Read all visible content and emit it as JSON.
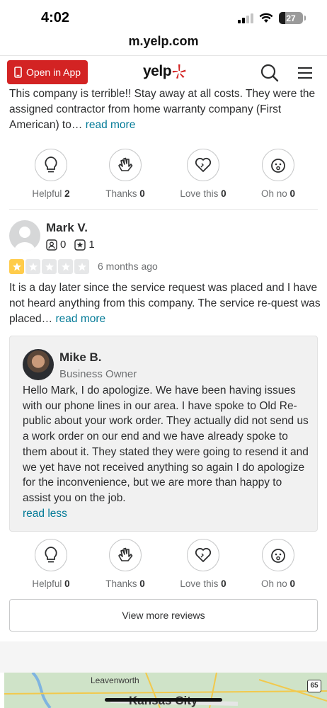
{
  "status_bar": {
    "time": "4:02",
    "battery": "27"
  },
  "browser": {
    "url": "m.yelp.com"
  },
  "header": {
    "open_in_app": "Open in App",
    "logo_text": "yelp",
    "brand_color": "#d32323"
  },
  "previous_review": {
    "text": "This company is terrible!! Stay away at all costs. They were the assigned contractor from home warranty company (First American) to…",
    "read_more": "read more",
    "reactions": [
      {
        "label": "Helpful",
        "count": "2"
      },
      {
        "label": "Thanks",
        "count": "0"
      },
      {
        "label": "Love this",
        "count": "0"
      },
      {
        "label": "Oh no",
        "count": "0"
      }
    ]
  },
  "review": {
    "reviewer_name": "Mark V.",
    "friends": "0",
    "reviews": "1",
    "rating": 1,
    "date": "6 months ago",
    "text": "It is a day later since the service request was placed and I have not heard anything from this company. The service re-quest was placed…",
    "read_more": "read more",
    "owner_reply": {
      "name": "Mike B.",
      "role": "Business Owner",
      "text": "Hello Mark, I do apologize. We have been having issues with our phone lines in our area. I have spoke to Old Re-public about your work order. They actually did not send us a work order on our end and we have already spoke to them about it. They stated they were going to resend it and we yet have not received anything so again I do apologize for the inconvenience, but we are more than happy to assist you on the job.",
      "read_less": "read less"
    },
    "reactions": [
      {
        "label": "Helpful",
        "count": "0"
      },
      {
        "label": "Thanks",
        "count": "0"
      },
      {
        "label": "Love this",
        "count": "0"
      },
      {
        "label": "Oh no",
        "count": "0"
      }
    ]
  },
  "view_more": "View more reviews",
  "map": {
    "label_1": "Leavenworth",
    "label_2": "Kansas City",
    "highway": "65"
  }
}
